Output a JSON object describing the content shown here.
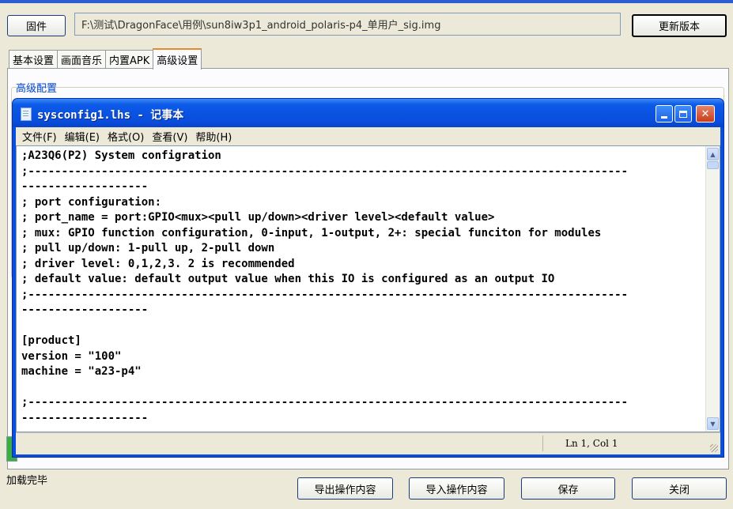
{
  "parent_window": {
    "firmware_button": "固件",
    "firmware_path": "F:\\测试\\DragonFace\\用例\\sun8iw3p1_android_polaris-p4_单用户_sig.img",
    "update_button": "更新版本",
    "tabs": [
      "基本设置",
      "画面音乐",
      "内置APK",
      "高级设置"
    ],
    "active_tab": "高级设置",
    "group_label": "高级配置",
    "status_text": "加载完毕",
    "buttons": {
      "export": "导出操作内容",
      "import": "导入操作内容",
      "save": "保存",
      "close": "关闭"
    }
  },
  "notepad": {
    "title": "sysconfig1.lhs - 记事本",
    "menus": [
      "文件(F)",
      "编辑(E)",
      "格式(O)",
      "查看(V)",
      "帮助(H)"
    ],
    "content": ";A23Q6(P2) System configration\n;------------------------------------------------------------------------------------------\n-------------------\n; port configuration:\n; port_name = port:GPIO<mux><pull up/down><driver level><default value>\n; mux: GPIO function configuration, 0-input, 1-output, 2+: special funciton for modules\n; pull up/down: 1-pull up, 2-pull down\n; driver level: 0,1,2,3. 2 is recommended\n; default value: default output value when this IO is configured as an output IO\n;------------------------------------------------------------------------------------------\n-------------------\n\n[product]\nversion = \"100\"\nmachine = \"a23-p4\"\n\n;------------------------------------------------------------------------------------------\n-------------------",
    "status_position": "Ln 1, Col 1"
  }
}
